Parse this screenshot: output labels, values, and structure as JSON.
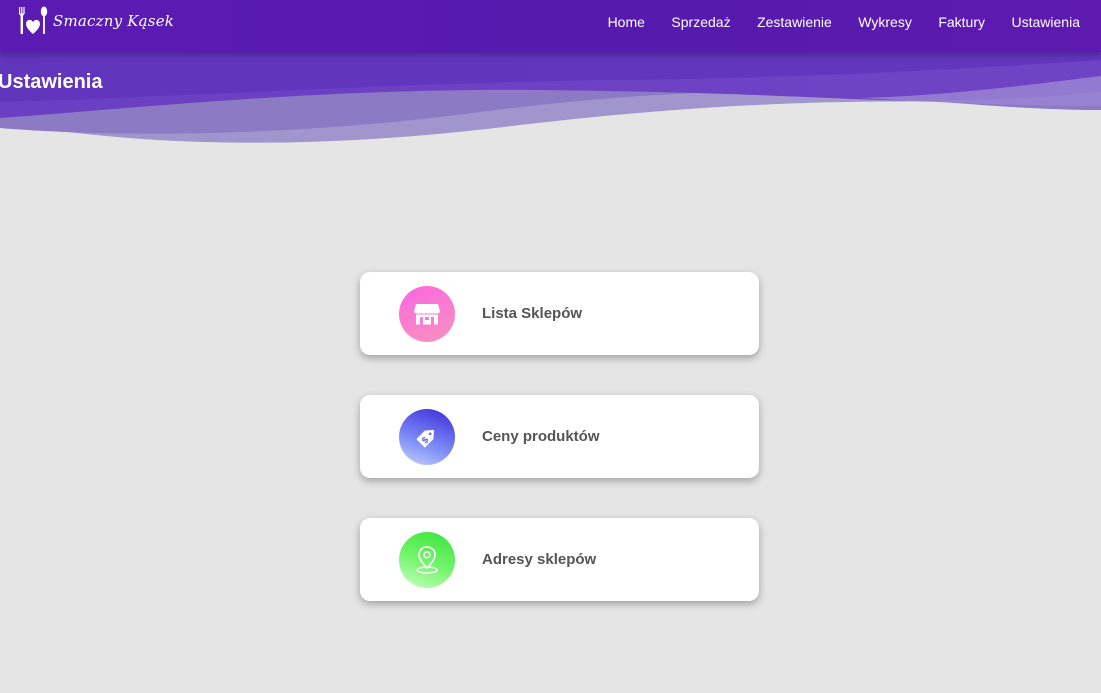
{
  "brand": {
    "name": "Smaczny Kąsek"
  },
  "nav": {
    "items": [
      {
        "label": "Home"
      },
      {
        "label": "Sprzedaż"
      },
      {
        "label": "Zestawienie"
      },
      {
        "label": "Wykresy"
      },
      {
        "label": "Faktury"
      },
      {
        "label": "Ustawienia"
      }
    ]
  },
  "header": {
    "title": "Ustawienia"
  },
  "cards": [
    {
      "label": "Lista Sklepów",
      "icon": "store-icon"
    },
    {
      "label": "Ceny produktów",
      "icon": "price-tag-icon"
    },
    {
      "label": "Adresy sklepów",
      "icon": "map-pin-icon"
    }
  ],
  "colors": {
    "navbar": "#561aae",
    "background": "#e5e5e5",
    "card_text": "#555555",
    "store_icon_gradient": [
      "#fb67e0",
      "#f891c0"
    ],
    "price_icon_gradient": [
      "#3c2ad9",
      "#c9d2ff"
    ],
    "address_icon_gradient": [
      "#38e238",
      "#c8ffc0"
    ]
  }
}
